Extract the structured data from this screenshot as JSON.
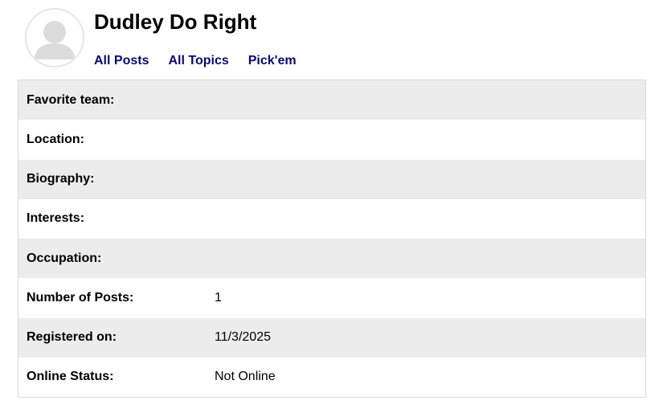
{
  "profile": {
    "name": "Dudley Do Right",
    "avatar_icon": "default-user-avatar-icon"
  },
  "nav": {
    "links": [
      {
        "label": "All Posts"
      },
      {
        "label": "All Topics"
      },
      {
        "label": "Pick'em"
      }
    ],
    "link_color": "#0a0a6e"
  },
  "details": {
    "rows": [
      {
        "label": "Favorite team:",
        "value": ""
      },
      {
        "label": "Location:",
        "value": ""
      },
      {
        "label": "Biography:",
        "value": ""
      },
      {
        "label": "Interests:",
        "value": ""
      },
      {
        "label": "Occupation:",
        "value": ""
      },
      {
        "label": "Number of Posts:",
        "value": "1"
      },
      {
        "label": "Registered on:",
        "value": "11/3/2025"
      },
      {
        "label": "Online Status:",
        "value": "Not Online"
      }
    ],
    "stripe_color": "#ececec"
  }
}
